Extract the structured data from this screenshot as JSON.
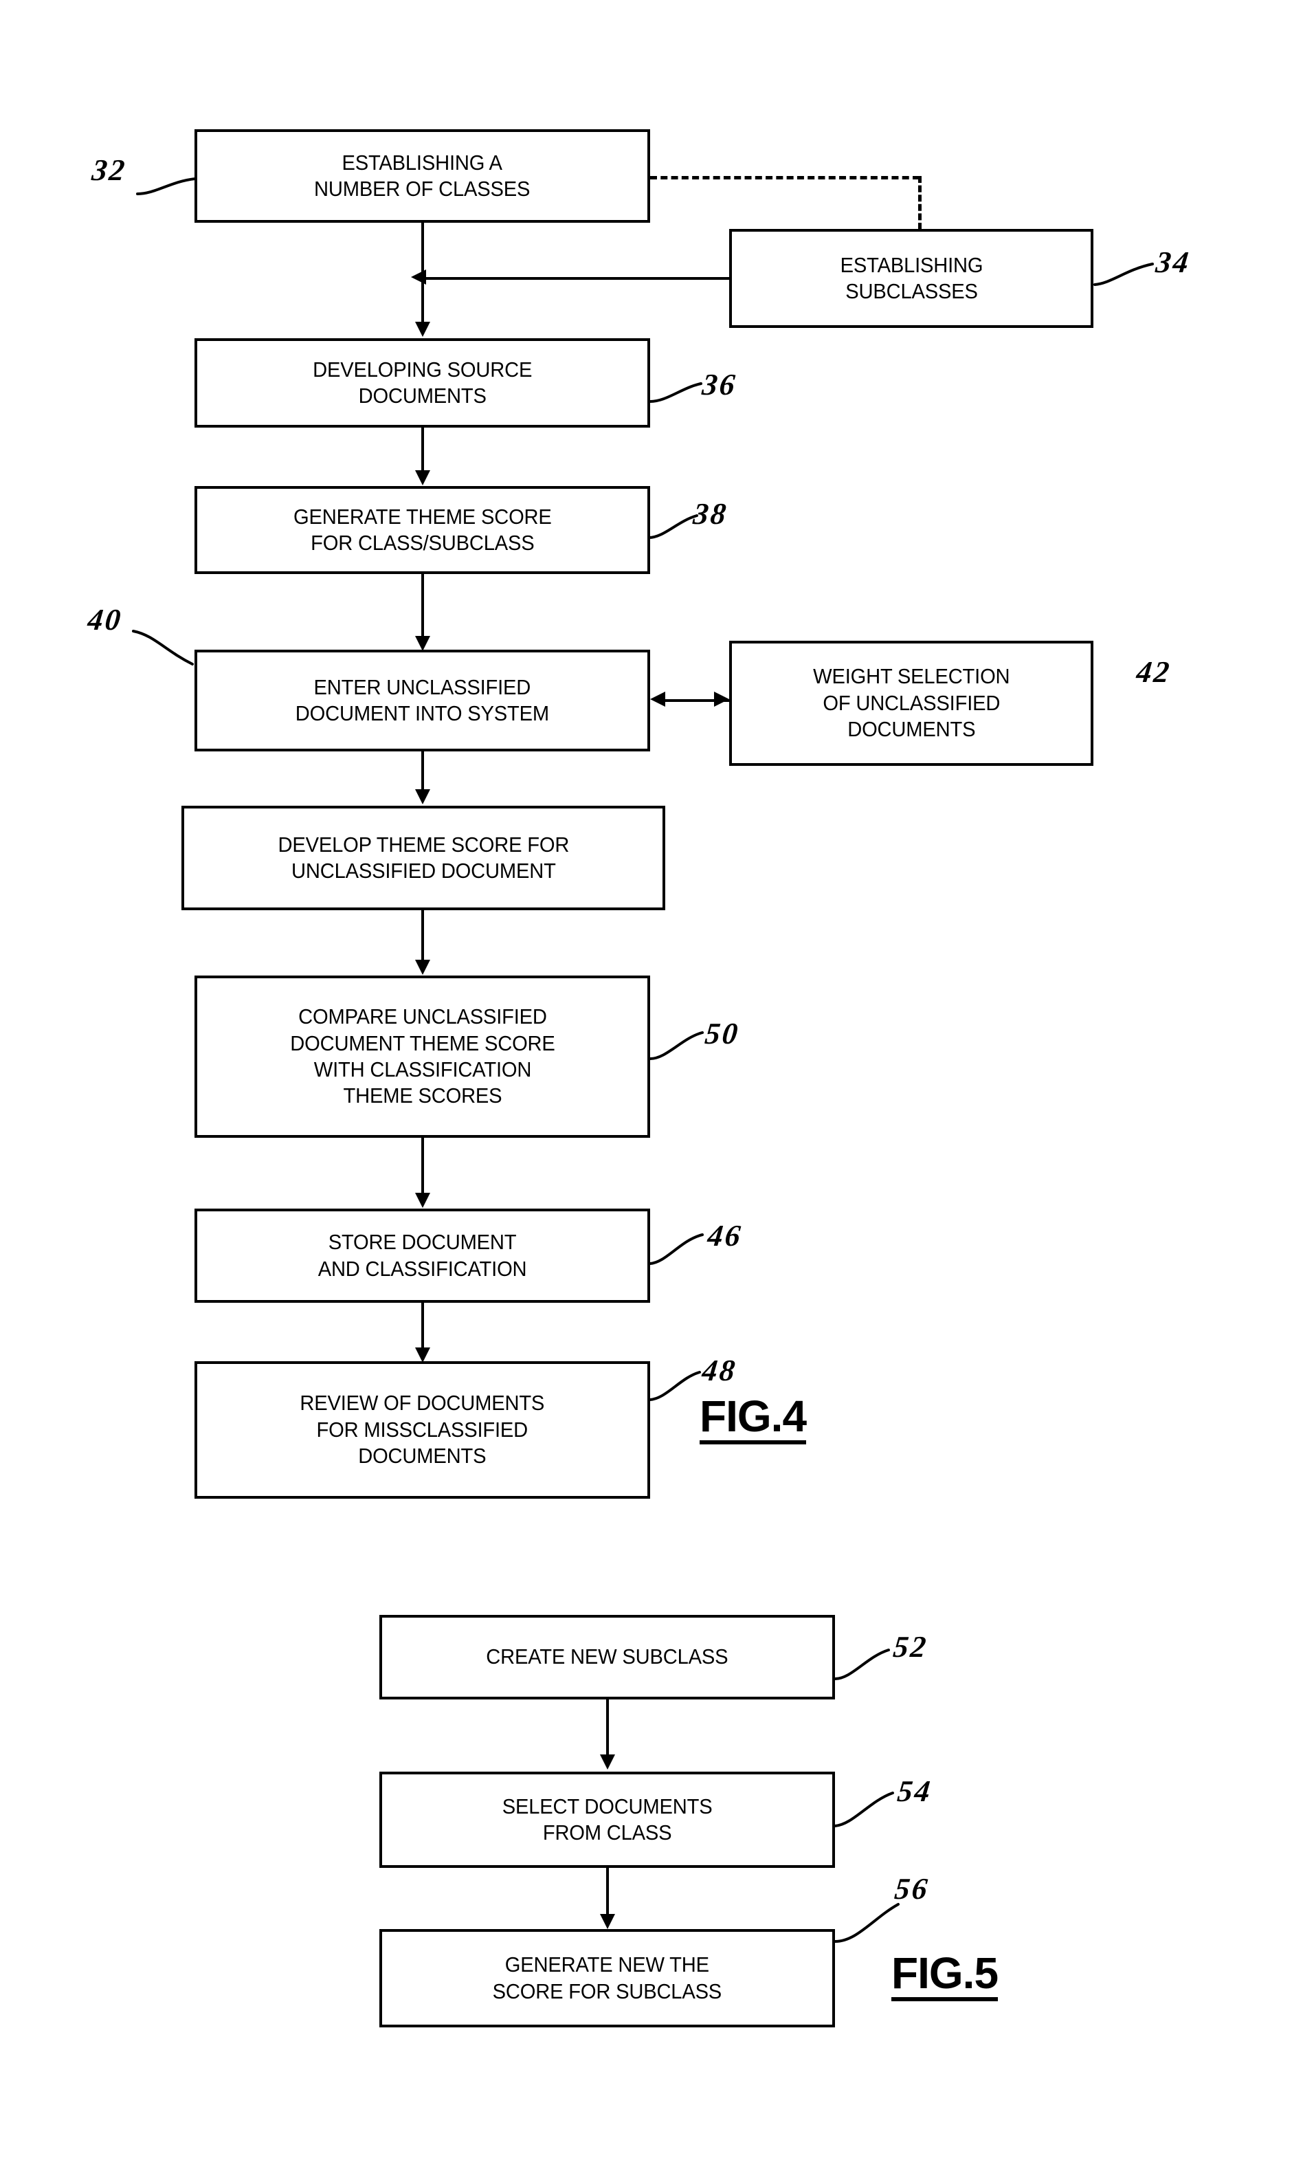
{
  "figures": [
    {
      "caption": "FIG.4",
      "boxes": [
        {
          "id": "b32",
          "ref": "32",
          "text": "ESTABLISHING A\nNUMBER OF CLASSES"
        },
        {
          "id": "b34",
          "ref": "34",
          "text": "ESTABLISHING\nSUBCLASSES"
        },
        {
          "id": "b36",
          "ref": "36",
          "text": "DEVELOPING SOURCE\nDOCUMENTS"
        },
        {
          "id": "b38",
          "ref": "38",
          "text": "GENERATE THEME SCORE\nFOR CLASS/SUBCLASS"
        },
        {
          "id": "b40",
          "ref": "40",
          "text": "ENTER UNCLASSIFIED\nDOCUMENT INTO SYSTEM"
        },
        {
          "id": "b42",
          "ref": "42",
          "text": "WEIGHT SELECTION\nOF UNCLASSIFIED\nDOCUMENTS"
        },
        {
          "id": "b44",
          "ref": "",
          "text": "DEVELOP THEME SCORE FOR\nUNCLASSIFIED DOCUMENT"
        },
        {
          "id": "b50",
          "ref": "50",
          "text": "COMPARE UNCLASSIFIED\nDOCUMENT THEME SCORE\nWITH CLASSIFICATION\nTHEME SCORES"
        },
        {
          "id": "b46",
          "ref": "46",
          "text": "STORE DOCUMENT\nAND CLASSIFICATION"
        },
        {
          "id": "b48",
          "ref": "48",
          "text": "REVIEW OF DOCUMENTS\nFOR MISSCLASSIFIED\nDOCUMENTS"
        }
      ]
    },
    {
      "caption": "FIG.5",
      "boxes": [
        {
          "id": "b52",
          "ref": "52",
          "text": "CREATE NEW SUBCLASS"
        },
        {
          "id": "b54",
          "ref": "54",
          "text": "SELECT DOCUMENTS\nFROM CLASS"
        },
        {
          "id": "b56",
          "ref": "56",
          "text": "GENERATE NEW THE\nSCORE FOR SUBCLASS"
        }
      ]
    }
  ],
  "chart_data": {
    "type": "diagram",
    "title": "Patent flowcharts FIG.4 and FIG.5 — document classification method",
    "nodes": [
      {
        "ref": "32",
        "label": "ESTABLISHING A NUMBER OF CLASSES",
        "figure": "FIG.4"
      },
      {
        "ref": "34",
        "label": "ESTABLISHING SUBCLASSES",
        "figure": "FIG.4"
      },
      {
        "ref": "36",
        "label": "DEVELOPING SOURCE DOCUMENTS",
        "figure": "FIG.4"
      },
      {
        "ref": "38",
        "label": "GENERATE THEME SCORE FOR CLASS/SUBCLASS",
        "figure": "FIG.4"
      },
      {
        "ref": "40",
        "label": "ENTER UNCLASSIFIED DOCUMENT INTO SYSTEM",
        "figure": "FIG.4"
      },
      {
        "ref": "42",
        "label": "WEIGHT SELECTION OF UNCLASSIFIED DOCUMENTS",
        "figure": "FIG.4"
      },
      {
        "ref": "",
        "label": "DEVELOP THEME SCORE FOR UNCLASSIFIED DOCUMENT",
        "figure": "FIG.4"
      },
      {
        "ref": "50",
        "label": "COMPARE UNCLASSIFIED DOCUMENT THEME SCORE WITH CLASSIFICATION THEME SCORES",
        "figure": "FIG.4"
      },
      {
        "ref": "46",
        "label": "STORE DOCUMENT AND CLASSIFICATION",
        "figure": "FIG.4"
      },
      {
        "ref": "48",
        "label": "REVIEW OF DOCUMENTS FOR MISSCLASSIFIED DOCUMENTS",
        "figure": "FIG.4"
      },
      {
        "ref": "52",
        "label": "CREATE NEW SUBCLASS",
        "figure": "FIG.5"
      },
      {
        "ref": "54",
        "label": "SELECT DOCUMENTS FROM CLASS",
        "figure": "FIG.5"
      },
      {
        "ref": "56",
        "label": "GENERATE NEW THE SCORE FOR SUBCLASS",
        "figure": "FIG.5"
      }
    ],
    "edges": [
      {
        "from": "32",
        "to": "36",
        "style": "solid",
        "direction": "down"
      },
      {
        "from": "32",
        "to": "34",
        "style": "dashed",
        "direction": "right-down"
      },
      {
        "from": "34",
        "to": "36",
        "style": "solid",
        "direction": "left"
      },
      {
        "from": "36",
        "to": "38",
        "style": "solid",
        "direction": "down"
      },
      {
        "from": "38",
        "to": "40",
        "style": "solid",
        "direction": "down"
      },
      {
        "from": "40",
        "to": "42",
        "style": "solid",
        "direction": "bidirectional"
      },
      {
        "from": "40",
        "to": "44",
        "style": "solid",
        "direction": "down"
      },
      {
        "from": "44",
        "to": "50",
        "style": "solid",
        "direction": "down"
      },
      {
        "from": "50",
        "to": "46",
        "style": "solid",
        "direction": "down"
      },
      {
        "from": "46",
        "to": "48",
        "style": "solid",
        "direction": "down"
      },
      {
        "from": "52",
        "to": "54",
        "style": "solid",
        "direction": "down"
      },
      {
        "from": "54",
        "to": "56",
        "style": "solid",
        "direction": "down"
      }
    ]
  }
}
